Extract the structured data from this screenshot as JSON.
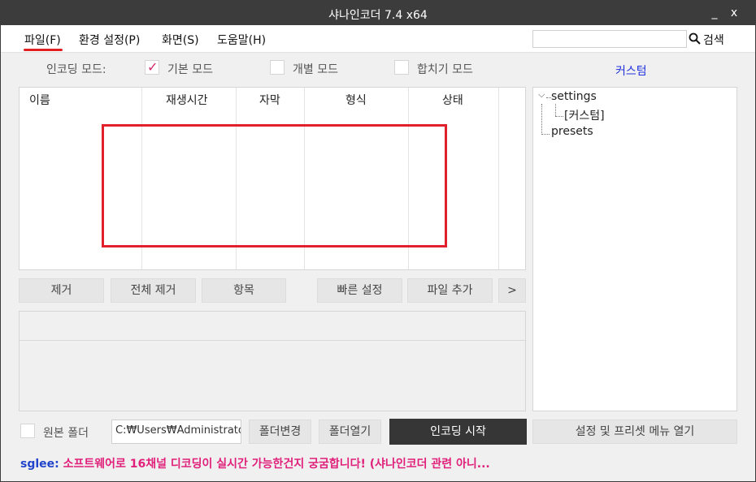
{
  "window": {
    "title": "샤나인코더  7.4 x64",
    "min_label": "_",
    "close_label": "x"
  },
  "menu": {
    "items": [
      "파일(F)",
      "환경 설정(P)",
      "화면(S)",
      "도움말(H)"
    ],
    "search_placeholder": "",
    "search_label": "검색"
  },
  "encoding_modes": {
    "label": "인코딩 모드:",
    "options": [
      {
        "label": "기본 모드",
        "checked": true
      },
      {
        "label": "개별 모드",
        "checked": false
      },
      {
        "label": "합치기 모드",
        "checked": false
      }
    ],
    "custom_link": "커스텀"
  },
  "file_list": {
    "columns": [
      "이름",
      "재생시간",
      "자막",
      "형식",
      "상태"
    ],
    "rows": []
  },
  "tree": {
    "root": "settings",
    "child": "[커스텀]",
    "sibling": "presets"
  },
  "list_buttons": {
    "remove": "제거",
    "remove_all": "전체 제거",
    "items": "항목",
    "quick_settings": "빠른 설정",
    "add_file": "파일 추가",
    "more": ">"
  },
  "bottom": {
    "source_folder_label": "원본 폴더",
    "output_path": "C:₩Users₩Administrato",
    "change_folder": "폴더변경",
    "open_folder": "폴더열기",
    "start_encoding": "인코딩 시작",
    "open_settings_menu": "설정 및 프리셋 메뉴 열기"
  },
  "status": {
    "user": "sglee:",
    "message": " 소프트웨어로 16채널 디코딩이 실시간 가능한건지 궁굼합니다! (샤나인코더 관련 아니..."
  },
  "colors": {
    "titlebar": "#3c3c3c",
    "accent_red": "#e0202a",
    "link_blue": "#2233dd",
    "status_pink": "#e0207a"
  }
}
